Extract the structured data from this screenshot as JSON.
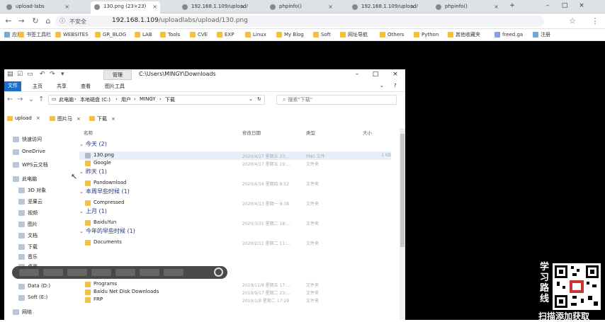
{
  "browser": {
    "tabs": [
      {
        "title": "upload-labs"
      },
      {
        "title": "130.png (23×23)"
      },
      {
        "title": "192.168.1.109/upload/..."
      },
      {
        "title": "phpinfo()"
      },
      {
        "title": "192.168.1.109/upload/..."
      },
      {
        "title": "phpinfo()"
      }
    ],
    "address": {
      "security": "不安全",
      "host": "192.168.1.109",
      "path": "/uploadlabs/upload/130.png"
    },
    "bookmarks": [
      "应用",
      "书签工具栏",
      "WEBSITES",
      "GR_BLOG",
      "LAB",
      "Tools",
      "CVE",
      "EXP",
      "Linux",
      "My Blog",
      "Soft",
      "网址导航",
      "Others",
      "Python",
      "其他收藏夹",
      "freed.ga",
      "注册"
    ]
  },
  "explorer": {
    "management_tab": "管理",
    "title_path": "C:\\Users\\MINGY\\Downloads",
    "ribbon": [
      "文件",
      "主页",
      "共享",
      "查看",
      "图片工具"
    ],
    "breadcrumb": [
      "此电脑",
      "本地磁盘 (C:)",
      "用户",
      "MINGY",
      "下载"
    ],
    "search_placeholder": "搜索\"下载\"",
    "quick_tabs": [
      "upload",
      "图片马",
      "下载"
    ],
    "sidebar": [
      {
        "label": "快速访问",
        "sub": false
      },
      {
        "label": "OneDrive",
        "sub": false
      },
      {
        "label": "WPS云文档",
        "sub": false
      },
      {
        "label": "此电脑",
        "sub": false
      },
      {
        "label": "3D 对象",
        "sub": true
      },
      {
        "label": "坚果云",
        "sub": true
      },
      {
        "label": "视频",
        "sub": true
      },
      {
        "label": "图片",
        "sub": true
      },
      {
        "label": "文档",
        "sub": true
      },
      {
        "label": "下载",
        "sub": true
      },
      {
        "label": "音乐",
        "sub": true
      },
      {
        "label": "桌面",
        "sub": true
      },
      {
        "label": "Data (D:)",
        "sub": true
      },
      {
        "label": "Soft (E:)",
        "sub": true
      },
      {
        "label": "网络",
        "sub": false
      }
    ],
    "columns": [
      "名称",
      "修改日期",
      "类型",
      "大小"
    ],
    "groups": [
      {
        "label": "今天 (2)",
        "files": [
          {
            "name": "130.png",
            "date": "2020/4/17 星期五 23:...",
            "type": "PNG 文件",
            "size": "1 KB",
            "kind": "img"
          },
          {
            "name": "Google",
            "date": "2020/4/17 星期五 19:...",
            "type": "文件夹",
            "size": "",
            "kind": "folder"
          }
        ]
      },
      {
        "label": "昨天 (1)",
        "files": [
          {
            "name": "Pandownload",
            "date": "2020/4/16 星期四 9:52",
            "type": "文件夹",
            "size": "",
            "kind": "folder"
          }
        ]
      },
      {
        "label": "本周早些时候 (1)",
        "files": [
          {
            "name": "Compressed",
            "date": "2020/4/13 星期一 9:38",
            "type": "文件夹",
            "size": "",
            "kind": "folder"
          }
        ]
      },
      {
        "label": "上月 (1)",
        "files": [
          {
            "name": "BaiduYun",
            "date": "2020/3/31 星期二 18:...",
            "type": "文件夹",
            "size": "",
            "kind": "folder"
          }
        ]
      },
      {
        "label": "今年的早些时候 (1)",
        "files": [
          {
            "name": "Documents",
            "date": "2020/2/11 星期二 11:...",
            "type": "文件夹",
            "size": "",
            "kind": "folder"
          }
        ]
      }
    ],
    "older_files": [
      {
        "name": "Programs",
        "date": "2019/11/8 星期五 17:...",
        "type": "文件夹",
        "size": "",
        "kind": "folder"
      },
      {
        "name": "Baidu Net Disk Downloads",
        "date": "2019/9/17 星期二 23:...",
        "type": "文件夹",
        "size": "",
        "kind": "folder"
      },
      {
        "name": "FRP",
        "date": "2019/1/8 星期二 17:29",
        "type": "文件夹",
        "size": "",
        "kind": "folder"
      }
    ]
  },
  "promo": {
    "vertical": "学习路线",
    "bottom": "扫描添加获取"
  }
}
